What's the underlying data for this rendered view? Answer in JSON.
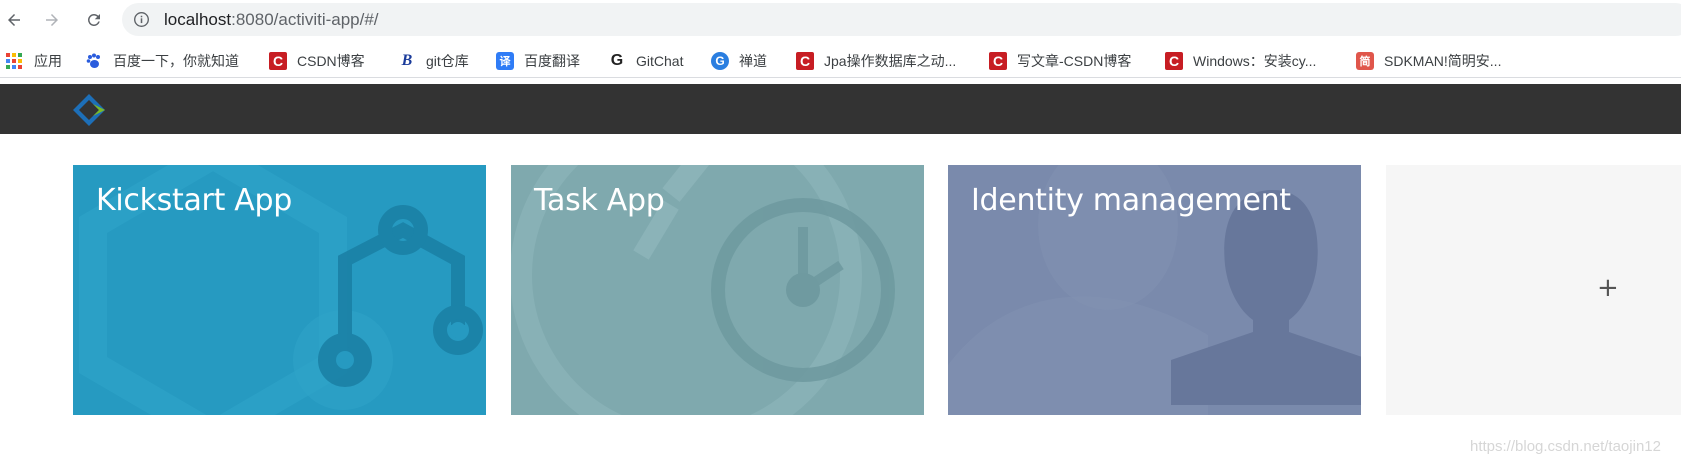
{
  "browser": {
    "url_host": "localhost",
    "url_rest": ":8080/activiti-app/#/",
    "icons": {
      "back": "arrow-left-icon",
      "forward": "arrow-right-icon",
      "reload": "reload-icon",
      "info": "info-circle-icon"
    }
  },
  "bookmarks": [
    {
      "label": "应用",
      "icon": "apps-grid-icon"
    },
    {
      "label": "百度一下，你就知道",
      "icon": "baidu-paw-icon",
      "glyph": "🐾"
    },
    {
      "label": "CSDN博客",
      "icon": "csdn-icon",
      "glyph": "C"
    },
    {
      "label": "git仓库",
      "icon": "git-b-icon",
      "glyph": "B"
    },
    {
      "label": "百度翻译",
      "icon": "fanyi-icon",
      "glyph": "译"
    },
    {
      "label": "GitChat",
      "icon": "gitchat-icon",
      "glyph": "G"
    },
    {
      "label": "禅道",
      "icon": "chandao-icon",
      "glyph": "G"
    },
    {
      "label": "Jpa操作数据库之动...",
      "icon": "csdn-icon",
      "glyph": "C"
    },
    {
      "label": "写文章-CSDN博客",
      "icon": "csdn-icon",
      "glyph": "C"
    },
    {
      "label": "Windows：安装cy...",
      "icon": "csdn-icon",
      "glyph": "C"
    },
    {
      "label": "SDKMAN!简明安...",
      "icon": "jian-icon",
      "glyph": "简"
    }
  ],
  "app": {
    "logo": "activiti-logo-icon",
    "brand_colors": {
      "blue": "#1d6fb8",
      "green": "#7ab929"
    },
    "header_color": "#333333"
  },
  "tiles": [
    {
      "title": "Kickstart App",
      "icon": "process-flow-icon",
      "color": "#269ac1"
    },
    {
      "title": "Task App",
      "icon": "clock-icon",
      "color": "#7fa9ae"
    },
    {
      "title": "Identity management",
      "icon": "user-silhouette-icon",
      "color": "#7a8aac"
    },
    {
      "title": "+",
      "icon": "plus-icon",
      "color": "#f6f6f6"
    }
  ],
  "watermark": "https://blog.csdn.net/taojin12"
}
